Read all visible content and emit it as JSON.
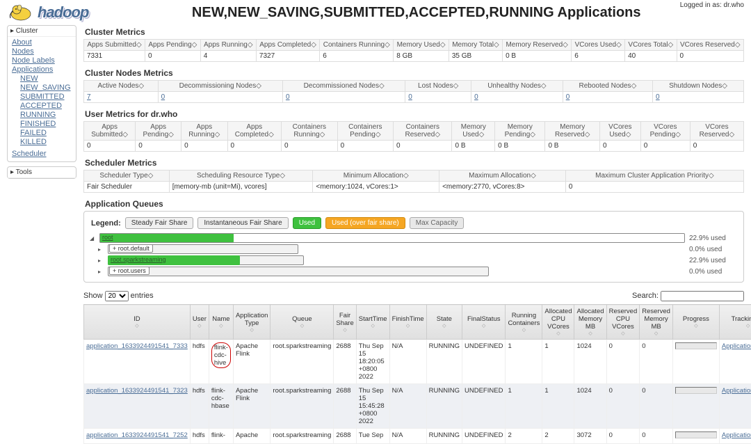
{
  "login_text": "Logged in as: dr.who",
  "page_title": "NEW,NEW_SAVING,SUBMITTED,ACCEPTED,RUNNING Applications",
  "logo_text": "hadoop",
  "sidebar": {
    "cluster_hdr": "▸ Cluster",
    "tools_hdr": "▸ Tools",
    "links": {
      "about": "About",
      "nodes": "Nodes",
      "node_labels": "Node Labels",
      "applications": "Applications",
      "new": "NEW",
      "new_saving": "NEW_SAVING",
      "submitted": "SUBMITTED",
      "accepted": "ACCEPTED",
      "running": "RUNNING",
      "finished": "FINISHED",
      "failed": "FAILED",
      "killed": "KILLED",
      "scheduler": "Scheduler"
    }
  },
  "sections": {
    "cluster_metrics": "Cluster Metrics",
    "cluster_nodes": "Cluster Nodes Metrics",
    "user_metrics": "User Metrics for dr.who",
    "scheduler_metrics": "Scheduler Metrics",
    "app_queues": "Application Queues"
  },
  "cluster_metrics": {
    "headers": [
      "Apps Submitted",
      "Apps Pending",
      "Apps Running",
      "Apps Completed",
      "Containers Running",
      "Memory Used",
      "Memory Total",
      "Memory Reserved",
      "VCores Used",
      "VCores Total",
      "VCores Reserved"
    ],
    "values": [
      "7331",
      "0",
      "4",
      "7327",
      "6",
      "8 GB",
      "35 GB",
      "0 B",
      "6",
      "40",
      "0"
    ]
  },
  "cluster_nodes": {
    "headers": [
      "Active Nodes",
      "Decommissioning Nodes",
      "Decommissioned Nodes",
      "Lost Nodes",
      "Unhealthy Nodes",
      "Rebooted Nodes",
      "Shutdown Nodes"
    ],
    "values": [
      "7",
      "0",
      "0",
      "0",
      "0",
      "0",
      "0"
    ]
  },
  "user_metrics": {
    "headers": [
      "Apps Submitted",
      "Apps Pending",
      "Apps Running",
      "Apps Completed",
      "Containers Running",
      "Containers Pending",
      "Containers Reserved",
      "Memory Used",
      "Memory Pending",
      "Memory Reserved",
      "VCores Used",
      "VCores Pending",
      "VCores Reserved"
    ],
    "values": [
      "0",
      "0",
      "0",
      "0",
      "0",
      "0",
      "0",
      "0 B",
      "0 B",
      "0 B",
      "0",
      "0",
      "0"
    ]
  },
  "scheduler_metrics": {
    "headers": [
      "Scheduler Type",
      "Scheduling Resource Type",
      "Minimum Allocation",
      "Maximum Allocation",
      "Maximum Cluster Application Priority"
    ],
    "values": [
      "Fair Scheduler",
      "[memory-mb (unit=Mi), vcores]",
      "<memory:1024, vCores:1>",
      "<memory:2770, vCores:8>",
      "0"
    ]
  },
  "legend": {
    "label": "Legend:",
    "steady": "Steady Fair Share",
    "instant": "Instantaneous Fair Share",
    "used": "Used",
    "over": "Used (over fair share)",
    "max": "Max Capacity"
  },
  "queues": {
    "root": {
      "name": "root",
      "used": "22.9% used"
    },
    "default": {
      "name": "+ root.default",
      "used": "0.0% used"
    },
    "spark": {
      "name": "root.sparkstreaming",
      "used": "22.9% used"
    },
    "users": {
      "name": "+ root.users",
      "used": "0.0% used"
    }
  },
  "datatable": {
    "show_prefix": "Show",
    "show_suffix": "entries",
    "page_size": "20",
    "search_label": "Search:"
  },
  "app_headers": [
    "ID",
    "User",
    "Name",
    "Application Type",
    "Queue",
    "Fair Share",
    "StartTime",
    "FinishTime",
    "State",
    "FinalStatus",
    "Running Containers",
    "Allocated CPU VCores",
    "Allocated Memory MB",
    "Reserved CPU VCores",
    "Reserved Memory MB",
    "Progress",
    "Tracking UI"
  ],
  "apps": [
    {
      "id": "application_1633924491541_7333",
      "user": "hdfs",
      "name": "flink-cdc-hive",
      "type": "Apache Flink",
      "queue": "root.sparkstreaming",
      "fair": "2688",
      "start": "Thu Sep 15 18:20:05 +0800 2022",
      "finish": "N/A",
      "state": "RUNNING",
      "final": "UNDEFINED",
      "rc": "1",
      "cpu": "1",
      "mem": "1024",
      "rcpu": "0",
      "rmem": "0",
      "track": "ApplicationMaster"
    },
    {
      "id": "application_1633924491541_7323",
      "user": "hdfs",
      "name": "flink-cdc-hbase",
      "type": "Apache Flink",
      "queue": "root.sparkstreaming",
      "fair": "2688",
      "start": "Thu Sep 15 15:45:28 +0800 2022",
      "finish": "N/A",
      "state": "RUNNING",
      "final": "UNDEFINED",
      "rc": "1",
      "cpu": "1",
      "mem": "1024",
      "rcpu": "0",
      "rmem": "0",
      "track": "ApplicationMaster"
    },
    {
      "id": "application_1633924491541_7252",
      "user": "hdfs",
      "name": "flink-",
      "type": "Apache",
      "queue": "root.sparkstreaming",
      "fair": "2688",
      "start": "Tue Sep",
      "finish": "N/A",
      "state": "RUNNING",
      "final": "UNDEFINED",
      "rc": "2",
      "cpu": "2",
      "mem": "3072",
      "rcpu": "0",
      "rmem": "0",
      "track": "ApplicationMaster"
    }
  ]
}
